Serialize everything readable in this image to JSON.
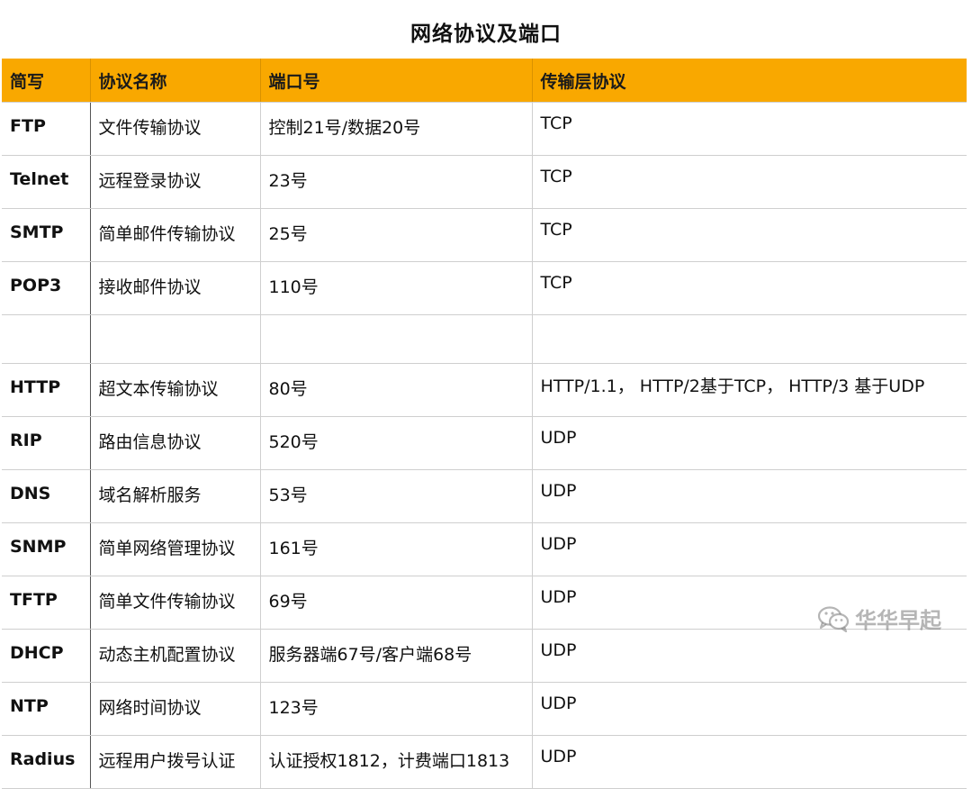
{
  "title": "网络协议及端口",
  "headers": [
    "简写",
    "协议名称",
    "端口号",
    "传输层协议"
  ],
  "rows": [
    [
      "FTP",
      "文件传输协议",
      "控制21号/数据20号",
      "TCP"
    ],
    [
      "Telnet",
      "远程登录协议",
      "23号",
      "TCP"
    ],
    [
      "SMTP",
      "简单邮件传输协议",
      "25号",
      "TCP"
    ],
    [
      "POP3",
      "接收邮件协议",
      "110号",
      "TCP"
    ],
    [
      "",
      "",
      "",
      ""
    ],
    [
      "HTTP",
      "超文本传输协议",
      "80号",
      "HTTP/1.1， HTTP/2基于TCP， HTTP/3 基于UDP"
    ],
    [
      "RIP",
      "路由信息协议",
      "520号",
      "UDP"
    ],
    [
      "DNS",
      "域名解析服务",
      "53号",
      "UDP"
    ],
    [
      "SNMP",
      "简单网络管理协议",
      "161号",
      "UDP"
    ],
    [
      "TFTP",
      "简单文件传输协议",
      "69号",
      "UDP"
    ],
    [
      "DHCP",
      "动态主机配置协议",
      "服务器端67号/客户端68号",
      "UDP"
    ],
    [
      "NTP",
      "网络时间协议",
      "123号",
      "UDP"
    ],
    [
      "Radius",
      "远程用户拨号认证",
      "认证授权1812，计费端口1813",
      "UDP"
    ]
  ],
  "watermark": {
    "text": "华华早起",
    "icon": "wechat-icon"
  },
  "colors": {
    "header_bg": "#f9a800",
    "grid": "#cfcfcf"
  }
}
